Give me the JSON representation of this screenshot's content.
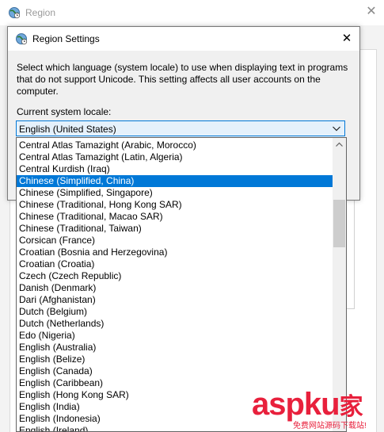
{
  "background_window": {
    "title": "Region",
    "close_glyph": "✕"
  },
  "dialog": {
    "title": "Region Settings",
    "close_glyph": "✕",
    "description": "Select which language (system locale) to use when displaying text in programs that do not support Unicode. This setting affects all user accounts on the computer.",
    "current_locale_label": "Current system locale:",
    "combo_value": "English (United States)",
    "icons": {
      "app": "globe-clock-icon",
      "combo_arrow": "chevron-down-icon",
      "scroll_up": "chevron-up-icon"
    }
  },
  "dropdown": {
    "selected_index": 3,
    "items": [
      "Central Atlas Tamazight (Arabic, Morocco)",
      "Central Atlas Tamazight (Latin, Algeria)",
      "Central Kurdish (Iraq)",
      "Chinese (Simplified, China)",
      "Chinese (Simplified, Singapore)",
      "Chinese (Traditional, Hong Kong SAR)",
      "Chinese (Traditional, Macao SAR)",
      "Chinese (Traditional, Taiwan)",
      "Corsican (France)",
      "Croatian (Bosnia and Herzegovina)",
      "Croatian (Croatia)",
      "Czech (Czech Republic)",
      "Danish (Denmark)",
      "Dari (Afghanistan)",
      "Dutch (Belgium)",
      "Dutch (Netherlands)",
      "Edo (Nigeria)",
      "English (Australia)",
      "English (Belize)",
      "English (Canada)",
      "English (Caribbean)",
      "English (Hong Kong SAR)",
      "English (India)",
      "English (Indonesia)",
      "English (Ireland)"
    ]
  },
  "watermark": {
    "brand": "aspku",
    "suffix": "家",
    "tagline": "免费网站源码下载站!"
  },
  "colors": {
    "selection": "#0078d7",
    "combo_bg": "#e5f1fb",
    "watermark": "#e8203c"
  }
}
